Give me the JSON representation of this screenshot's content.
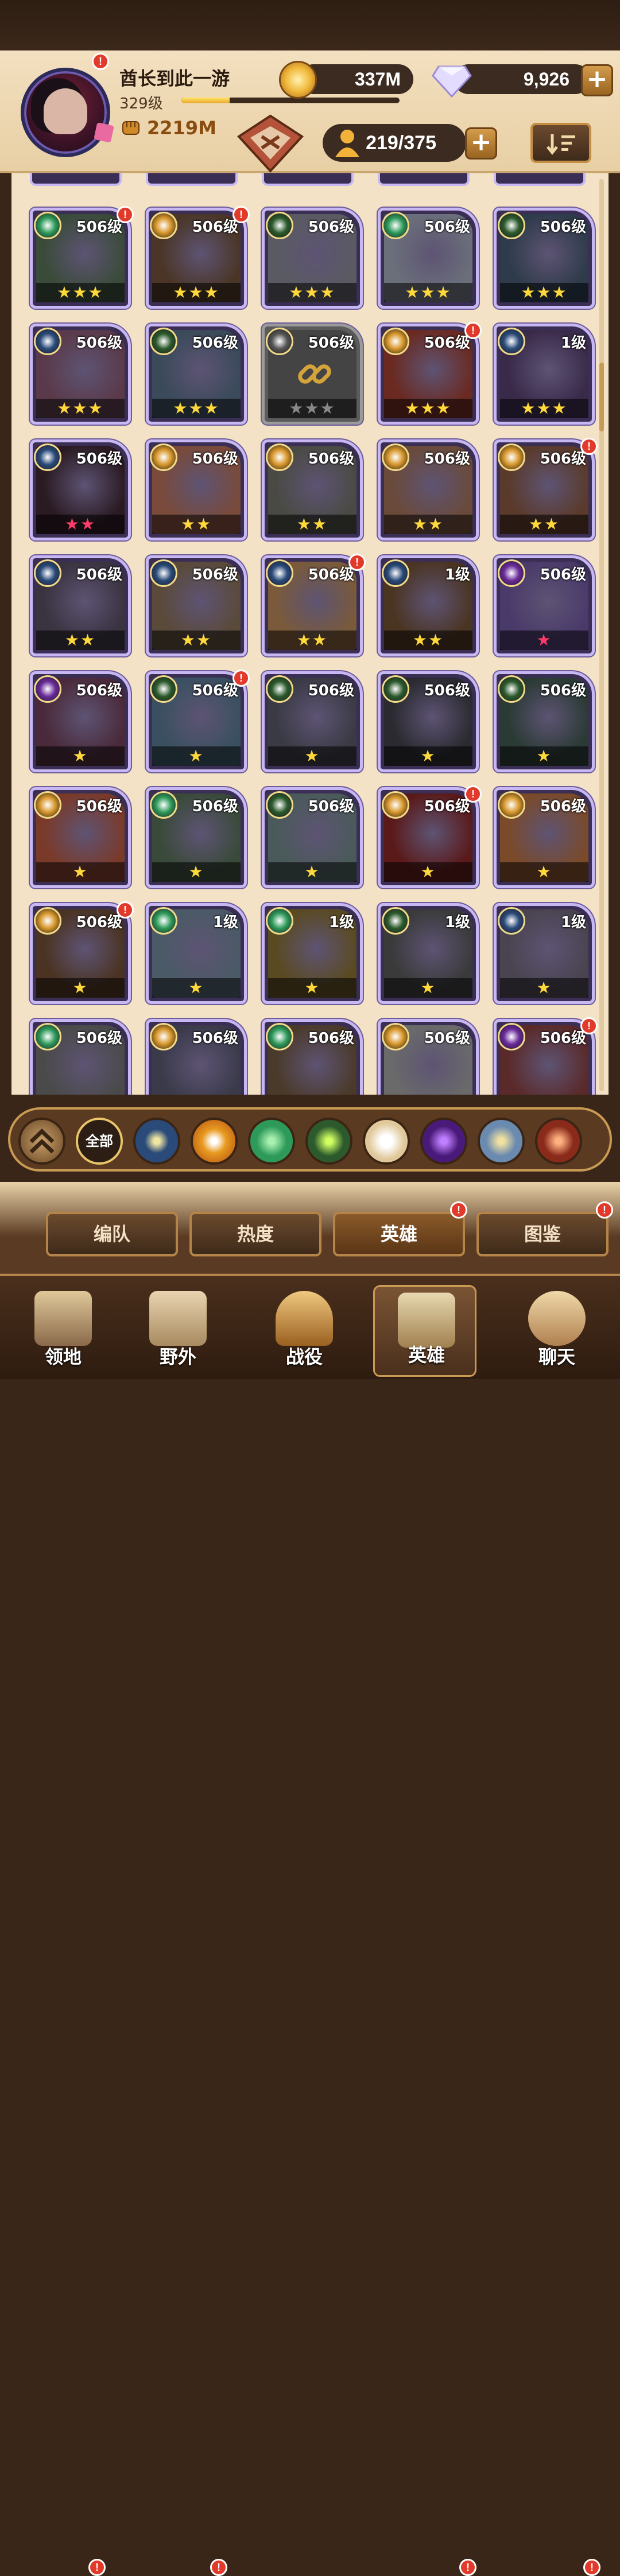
{
  "header": {
    "player_name": "酋长到此一游",
    "player_level": "329级",
    "xp_fraction": 0.22,
    "power": "2219M",
    "gold": "337M",
    "diamonds": "9,926",
    "hero_count": "219/375",
    "plus_label": "+"
  },
  "roster": {
    "rows": [
      [
        {
          "lvl": "506级",
          "stars": "★★★",
          "fac": "forest",
          "dot": true,
          "art": "#3a4b3a"
        },
        {
          "lvl": "506级",
          "stars": "★★★",
          "fac": "light",
          "dot": true,
          "art": "#4a3526"
        },
        {
          "lvl": "506级",
          "stars": "★★★",
          "fac": "wild",
          "dot": false,
          "art": "#5a5a62"
        },
        {
          "lvl": "506级",
          "stars": "★★★",
          "fac": "forest",
          "dot": false,
          "art": "#6a6f7a"
        },
        {
          "lvl": "506级",
          "stars": "★★★",
          "fac": "wild",
          "dot": false,
          "art": "#2e3b4a"
        }
      ],
      [
        {
          "lvl": "506级",
          "stars": "★★★",
          "fac": "celestial",
          "dot": false,
          "art": "#5a3a4a"
        },
        {
          "lvl": "506级",
          "stars": "★★★",
          "fac": "wild",
          "dot": false,
          "art": "#3a4a5a"
        },
        {
          "lvl": "506级",
          "stars": "★★★",
          "fac": "locked",
          "dot": false,
          "art": "#444",
          "locked": true
        },
        {
          "lvl": "506级",
          "stars": "★★★",
          "fac": "light",
          "dot": true,
          "art": "#6a2a22"
        },
        {
          "lvl": "1级",
          "stars": "★★★",
          "fac": "celestial",
          "dot": false,
          "art": "#3a2a4a"
        }
      ],
      [
        {
          "lvl": "506级",
          "stars": "★★",
          "fac": "celestial",
          "dot": false,
          "art": "#2a1a22",
          "red": true
        },
        {
          "lvl": "506级",
          "stars": "★★",
          "fac": "light",
          "dot": false,
          "art": "#7a4a3a"
        },
        {
          "lvl": "506级",
          "stars": "★★",
          "fac": "light",
          "dot": false,
          "art": "#4a4a44"
        },
        {
          "lvl": "506级",
          "stars": "★★",
          "fac": "light",
          "dot": false,
          "art": "#6a4a3a"
        },
        {
          "lvl": "506级",
          "stars": "★★",
          "fac": "light",
          "dot": true,
          "art": "#5a3a2a"
        }
      ],
      [
        {
          "lvl": "506级",
          "stars": "★★",
          "fac": "celestial",
          "dot": false,
          "art": "#3a3340"
        },
        {
          "lvl": "506级",
          "stars": "★★",
          "fac": "celestial",
          "dot": false,
          "art": "#5a4a3a"
        },
        {
          "lvl": "506级",
          "stars": "★★",
          "fac": "celestial",
          "dot": true,
          "art": "#7a5a3a"
        },
        {
          "lvl": "1级",
          "stars": "★★",
          "fac": "celestial",
          "dot": false,
          "art": "#4a3422"
        },
        {
          "lvl": "506级",
          "stars": "★",
          "fac": "void",
          "dot": false,
          "art": "#4a3a6a",
          "red": true
        }
      ],
      [
        {
          "lvl": "506级",
          "stars": "★",
          "fac": "void",
          "dot": false,
          "art": "#4a2a3a"
        },
        {
          "lvl": "506级",
          "stars": "★",
          "fac": "wild",
          "dot": true,
          "art": "#3a5060"
        },
        {
          "lvl": "506级",
          "stars": "★",
          "fac": "wild",
          "dot": false,
          "art": "#3a3a44"
        },
        {
          "lvl": "506级",
          "stars": "★",
          "fac": "wild",
          "dot": false,
          "art": "#2a2a30"
        },
        {
          "lvl": "506级",
          "stars": "★",
          "fac": "wild",
          "dot": false,
          "art": "#2a3a34"
        }
      ],
      [
        {
          "lvl": "506级",
          "stars": "★",
          "fac": "light",
          "dot": false,
          "art": "#7a3a2a"
        },
        {
          "lvl": "506级",
          "stars": "★",
          "fac": "forest",
          "dot": false,
          "art": "#3a4a3a"
        },
        {
          "lvl": "506级",
          "stars": "★",
          "fac": "wild",
          "dot": false,
          "art": "#4a5a5a"
        },
        {
          "lvl": "506级",
          "stars": "★",
          "fac": "light",
          "dot": true,
          "art": "#5a1a1a"
        },
        {
          "lvl": "506级",
          "stars": "★",
          "fac": "light",
          "dot": false,
          "art": "#7a4a2a"
        }
      ],
      [
        {
          "lvl": "506级",
          "stars": "★",
          "fac": "light",
          "dot": true,
          "art": "#4a3322"
        },
        {
          "lvl": "1级",
          "stars": "★",
          "fac": "forest",
          "dot": false,
          "art": "#4a5a66"
        },
        {
          "lvl": "1级",
          "stars": "★",
          "fac": "forest",
          "dot": false,
          "art": "#5a4a22"
        },
        {
          "lvl": "1级",
          "stars": "★",
          "fac": "wild",
          "dot": false,
          "art": "#3a3a3a"
        },
        {
          "lvl": "1级",
          "stars": "★",
          "fac": "celestial",
          "dot": false,
          "art": "#4a4450"
        }
      ],
      [
        {
          "lvl": "506级",
          "stars": "",
          "fac": "forest",
          "dot": false,
          "art": "#4a4a4a"
        },
        {
          "lvl": "506级",
          "stars": "",
          "fac": "light",
          "dot": false,
          "art": "#3a3a4a"
        },
        {
          "lvl": "506级",
          "stars": "",
          "fac": "forest",
          "dot": false,
          "art": "#4a3a2a"
        },
        {
          "lvl": "506级",
          "stars": "",
          "fac": "light",
          "dot": false,
          "art": "#6a6a6a"
        },
        {
          "lvl": "506级",
          "stars": "",
          "fac": "void",
          "dot": true,
          "art": "#5a2a2a"
        }
      ]
    ]
  },
  "filters": {
    "all_label": "全部",
    "items": [
      "up",
      "all",
      "celestial",
      "light",
      "forest",
      "wild",
      "dawn",
      "void",
      "dimensional",
      "graveborn"
    ]
  },
  "tabs": [
    "编队",
    "热度",
    "英雄",
    "图鉴"
  ],
  "nav": [
    "领地",
    "野外",
    "战役",
    "英雄",
    "聊天"
  ],
  "colors": {
    "forest": "#2e9a5a",
    "light": "#d7962a",
    "wild": "#2c5a2c",
    "celestial": "#2a4a7a",
    "void": "#6a2a9a",
    "locked": "#555555",
    "badge_red": "#e23a2a"
  }
}
